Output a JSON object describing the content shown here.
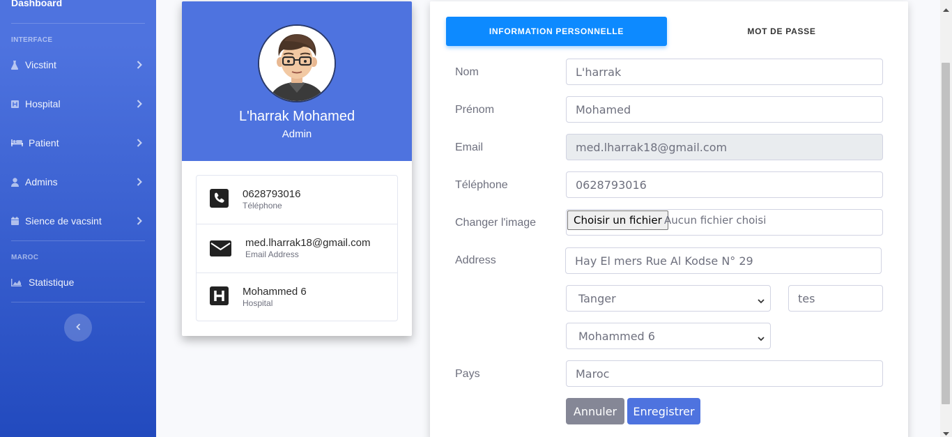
{
  "sidebar": {
    "brand": "Dashboard",
    "heading_interface": "INTERFACE",
    "heading_maroc": "MAROC",
    "items": [
      {
        "label": "Vicstint",
        "icon": "flask-icon"
      },
      {
        "label": "Hospital",
        "icon": "hospital-icon"
      },
      {
        "label": "Patient",
        "icon": "bed-icon"
      },
      {
        "label": "Admins",
        "icon": "user-icon"
      },
      {
        "label": "Sience de vacsint",
        "icon": "calendar-icon"
      }
    ],
    "maroc_items": [
      {
        "label": "Statistique",
        "icon": "chart-area-icon"
      }
    ]
  },
  "profile": {
    "name": "L'harrak Mohamed",
    "role": "Admin",
    "info": [
      {
        "value": "0628793016",
        "label": "Téléphone",
        "icon": "phone-icon"
      },
      {
        "value": "med.lharrak18@gmail.com",
        "label": "Email Address",
        "icon": "envelope-icon"
      },
      {
        "value": "Mohammed 6",
        "label": "Hospital",
        "icon": "hospital-icon"
      }
    ]
  },
  "form": {
    "tabs": {
      "active": "INFORMATION PERSONNELLE",
      "other": "MOT DE PASSE"
    },
    "labels": {
      "nom": "Nom",
      "prenom": "Prénom",
      "email": "Email",
      "telephone": "Téléphone",
      "image": "Changer l'image",
      "address": "Address",
      "pays": "Pays"
    },
    "values": {
      "nom": "L'harrak",
      "prenom": "Mohamed",
      "email": "med.lharrak18@gmail.com",
      "telephone": "0628793016",
      "address": "Hay El mers Rue Al Kodse N° 29",
      "city": "Tanger",
      "postal": "tes",
      "hospital": "Mohammed 6",
      "pays": "Maroc"
    },
    "file": {
      "button": "Choisir un fichier",
      "status": "Aucun fichier choisi"
    },
    "buttons": {
      "cancel": "Annuler",
      "save": "Enregistrer"
    }
  },
  "colors": {
    "primary": "#4e73df",
    "tab_active": "#0d8aff",
    "secondary": "#858796"
  }
}
